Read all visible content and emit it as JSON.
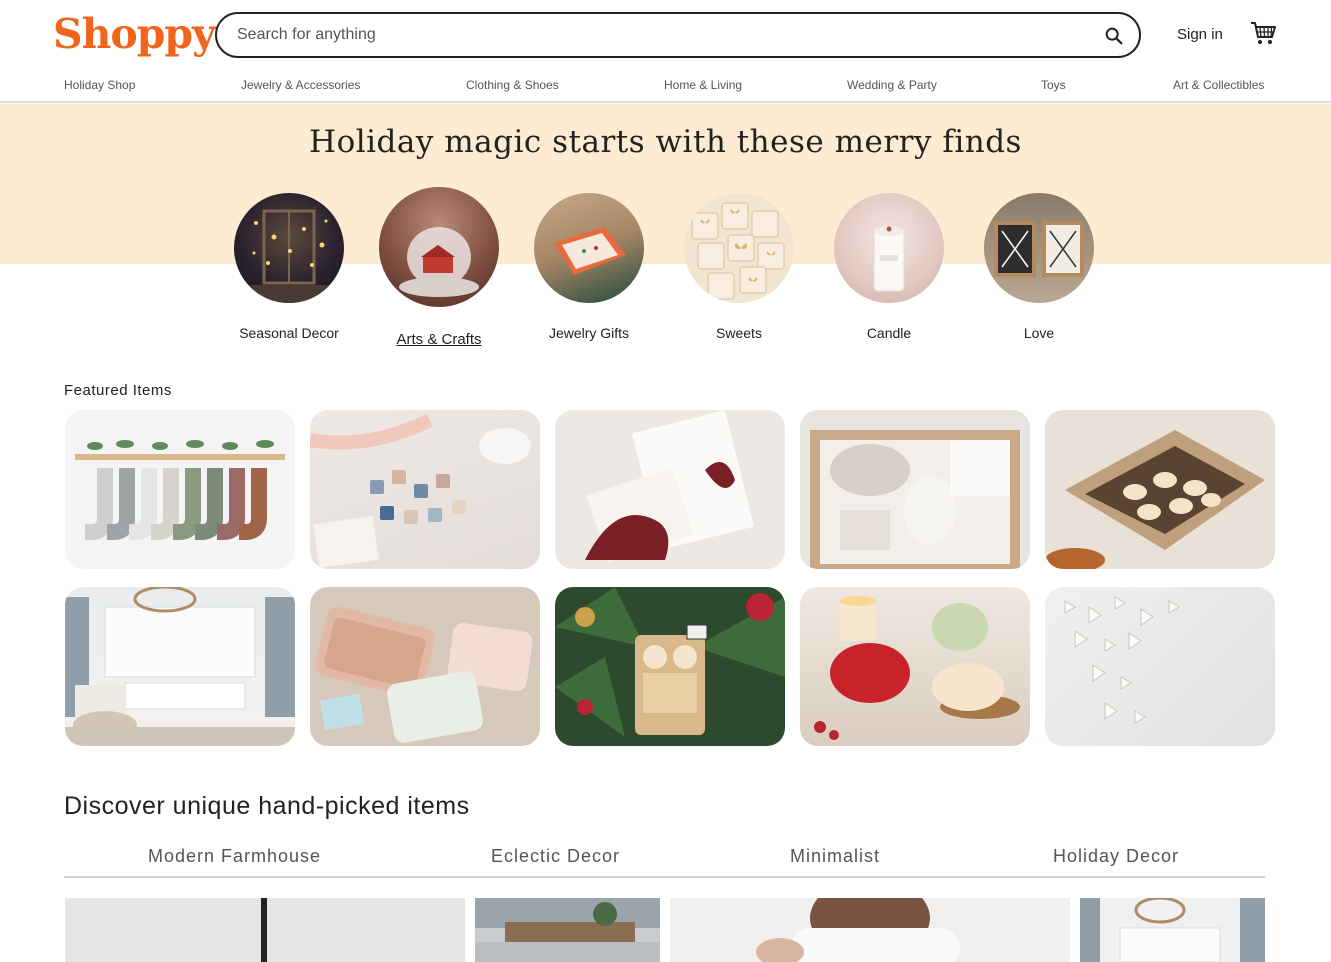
{
  "header": {
    "logo": "Shoppy",
    "search_placeholder": "Search for anything",
    "signin_label": "Sign in",
    "search_icon": "search-icon",
    "cart_icon": "cart-icon"
  },
  "categories": [
    "Holiday Shop",
    "Jewelry & Accessories",
    "Clothing & Shoes",
    "Home & Living",
    "Wedding & Party",
    "Toys",
    "Art & Collectibles"
  ],
  "hero": {
    "title": "Holiday magic starts with these merry finds",
    "items": [
      {
        "label": "Seasonal Decor",
        "active": false
      },
      {
        "label": "Arts & Crafts",
        "active": true
      },
      {
        "label": "Jewelry Gifts",
        "active": false
      },
      {
        "label": "Sweets",
        "active": false
      },
      {
        "label": "Candle",
        "active": false
      },
      {
        "label": "Love",
        "active": false
      }
    ]
  },
  "featured": {
    "title": "Featured Items"
  },
  "discover": {
    "title": "Discover unique hand-picked items",
    "tabs": [
      "Modern Farmhouse",
      "Eclectic Decor",
      "Minimalist",
      "Holiday Decor"
    ]
  },
  "colors": {
    "brand": "#f1641e",
    "hero_bg": "#fdebd2"
  }
}
